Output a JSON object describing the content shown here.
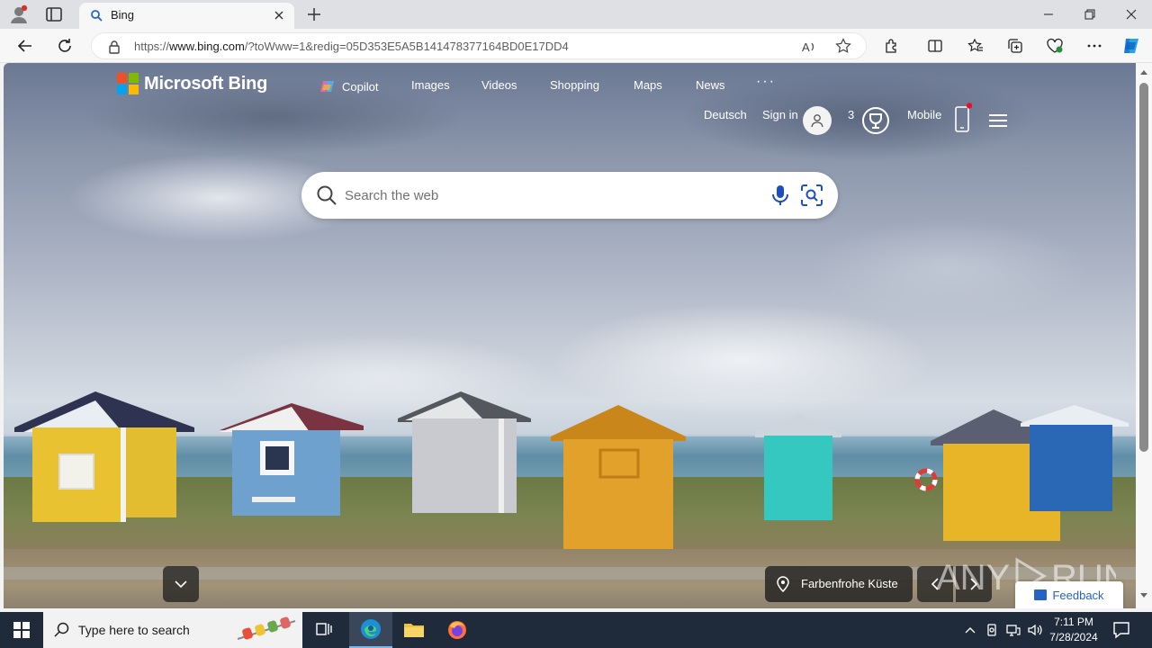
{
  "browser": {
    "tab_title": "Bing",
    "url_prefix": "https://",
    "url_host": "www.bing.com",
    "url_rest": "/?toWww=1&redig=05D353E5A5B141478377164BD0E17DD4"
  },
  "bing": {
    "brand": "Microsoft Bing",
    "nav": {
      "copilot": "Copilot",
      "images": "Images",
      "videos": "Videos",
      "shopping": "Shopping",
      "maps": "Maps",
      "news": "News",
      "more": "···"
    },
    "language": "Deutsch",
    "sign_in": "Sign in",
    "rewards_count": "3",
    "mobile": "Mobile",
    "search_placeholder": "Search the web",
    "location": "Farbenfrohe Küste",
    "feedback": "Feedback"
  },
  "taskbar": {
    "search_placeholder": "Type here to search",
    "time": "7:11 PM",
    "date": "7/28/2024"
  },
  "colors": {
    "bing_blue": "#2763c4",
    "taskbar_bg": "#1f2a3a",
    "logo_red": "#f25022",
    "logo_green": "#7fba00",
    "logo_blue": "#00a4ef",
    "logo_yellow": "#ffb900"
  }
}
